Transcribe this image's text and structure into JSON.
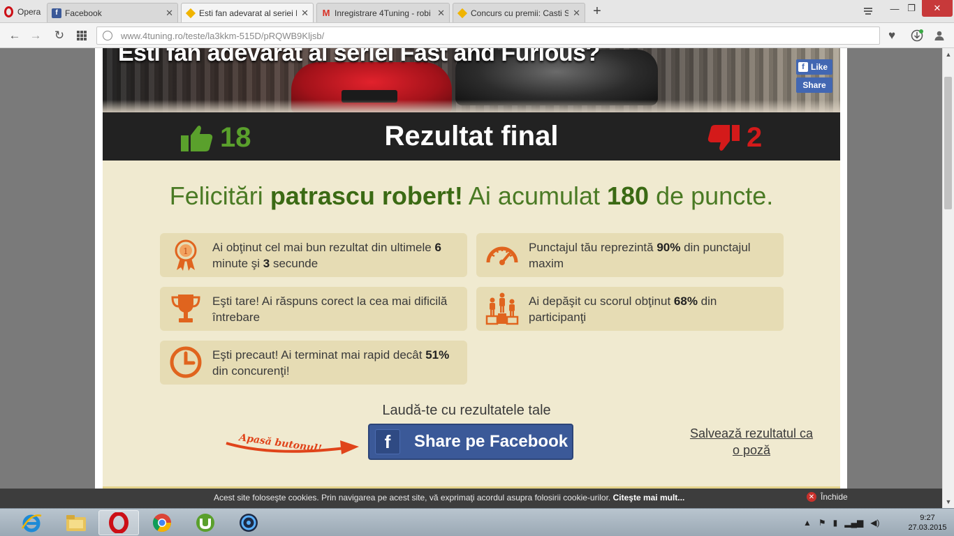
{
  "browser": {
    "menu_label": "Opera",
    "tabs": [
      {
        "label": "Facebook",
        "favicon": "facebook-icon"
      },
      {
        "label": "Esti fan adevarat al seriei F",
        "favicon": "4tuning-icon",
        "active": true
      },
      {
        "label": "Inregistrare 4Tuning - robi",
        "favicon": "gmail-icon"
      },
      {
        "label": "Concurs cu premii: Casti Sk",
        "favicon": "4tuning-icon"
      }
    ],
    "new_tab": "+",
    "url_domain": "www.4tuning.ro",
    "url_path": "/teste/la3kkm-515D/pRQWB9Kljsb/"
  },
  "hero": {
    "title": "Esti fan adevarat al seriei Fast and Furious?",
    "like_label": "Like",
    "share_label": "Share"
  },
  "result": {
    "up_count": "18",
    "title": "Rezultat final",
    "down_count": "2"
  },
  "congrats": {
    "prefix": "Felicitări ",
    "name": "patrascu robert!",
    "middle": " Ai acumulat ",
    "points": "180",
    "suffix": " de puncte."
  },
  "stats": {
    "best": {
      "a": "Ai obţinut cel mai bun rezultat din ultimele ",
      "b": "6",
      "c": " minute şi ",
      "d": "3",
      "e": " secunde"
    },
    "percent": {
      "a": "Punctajul tău reprezintă ",
      "b": "90%",
      "c": " din punctajul maxim"
    },
    "hardest": {
      "a": "Eşti tare! Ai răspuns corect la cea mai dificilă întrebare"
    },
    "beaten": {
      "a": "Ai depăşit cu scorul obţinut ",
      "b": "68%",
      "c": " din participanţi"
    },
    "speed": {
      "a": "Eşti precaut! Ai terminat mai rapid decât ",
      "b": "51%",
      "c": " din concurenţi!"
    }
  },
  "brag": {
    "heading": "Laudă-te cu rezultatele tale",
    "press_label": "Apasă butonul!",
    "share_button": "Share pe Facebook",
    "save_link": "Salvează rezultatul ca o poză"
  },
  "cookie": {
    "text": "Acest site foloseşte cookies. Prin navigarea pe acest site, vă exprimaţi acordul asupra folosirii cookie-urilor. ",
    "more": "Citeşte mai mult...",
    "close": "Închide"
  },
  "taskbar": {
    "time": "9:27",
    "date": "27.03.2015"
  },
  "colors": {
    "green": "#5aa02c",
    "red": "#d41a1a",
    "orange": "#e0641e",
    "facebook": "#3b5998",
    "panel": "#f0ead0",
    "card": "#e6dcb4"
  }
}
